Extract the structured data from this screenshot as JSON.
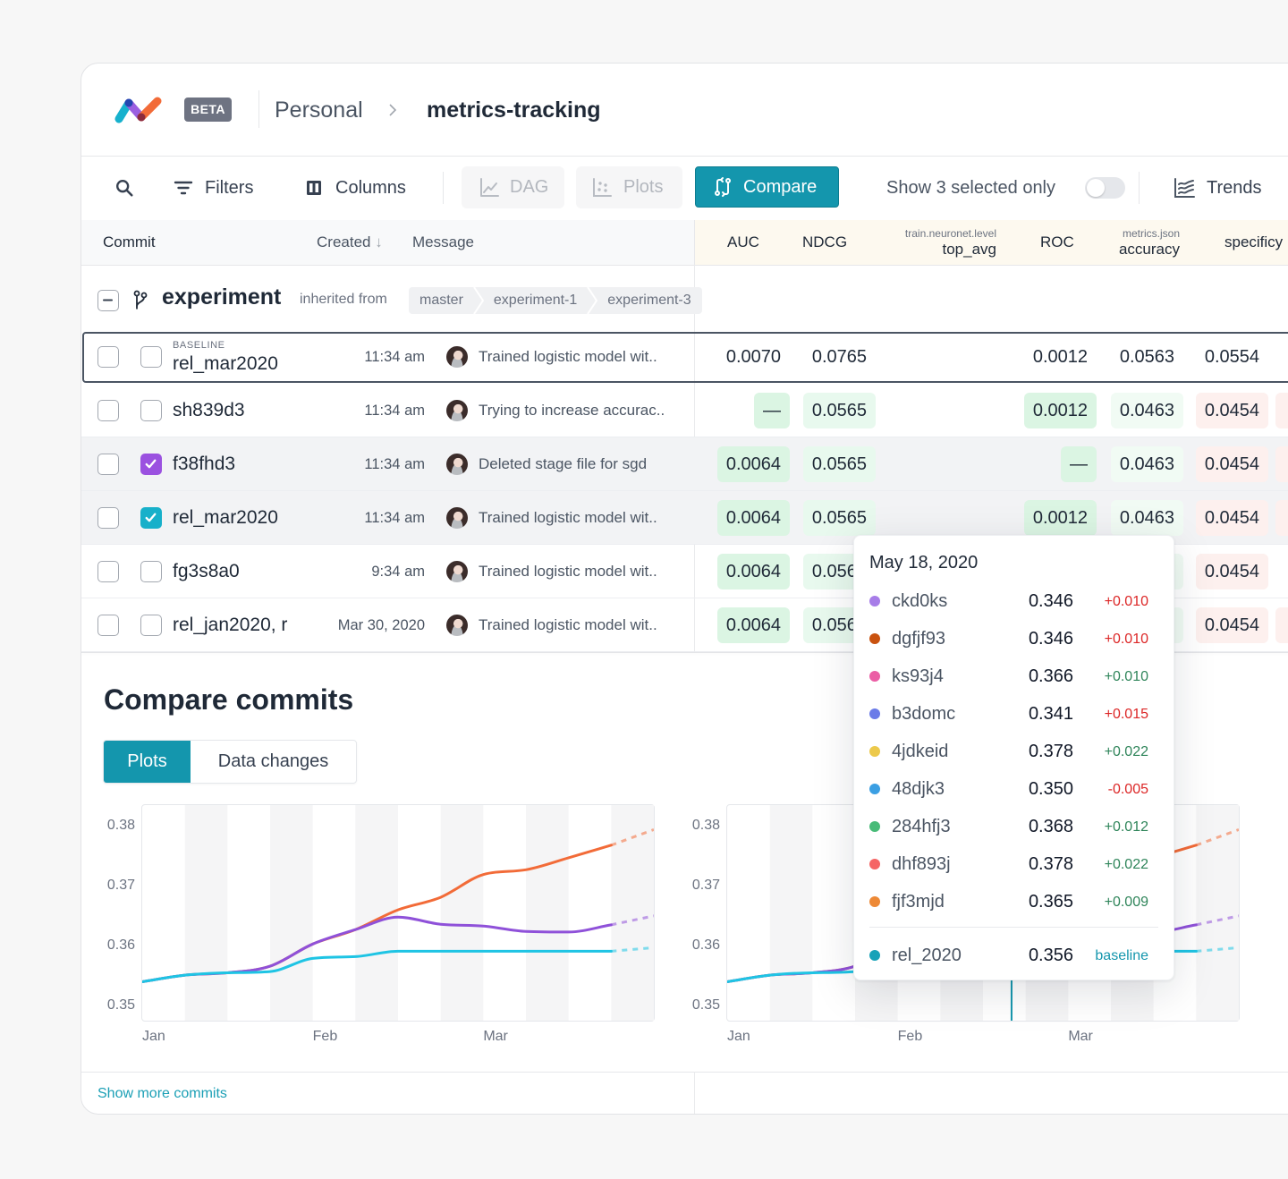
{
  "app": {
    "badge": "BETA"
  },
  "breadcrumb": {
    "workspace": "Personal",
    "project": "metrics-tracking"
  },
  "toolbar": {
    "filters": "Filters",
    "columns": "Columns",
    "dag": "DAG",
    "plots": "Plots",
    "compare": "Compare",
    "show_selected": "Show 3 selected only",
    "show_selected_on": false,
    "trends": "Trends"
  },
  "table": {
    "headers": {
      "commit": "Commit",
      "created": "Created",
      "created_sort": "↓",
      "message": "Message"
    },
    "metric_columns": [
      {
        "label": "AUC",
        "prefix": ""
      },
      {
        "label": "NDCG",
        "prefix": ""
      },
      {
        "label": "top_avg",
        "prefix": "train.neuronet.level"
      },
      {
        "label": "ROC",
        "prefix": ""
      },
      {
        "label": "accuracy",
        "prefix": "metrics.json"
      },
      {
        "label": "specificy",
        "prefix": ""
      }
    ],
    "group": {
      "name": "experiment",
      "inherited_label": "inherited from",
      "lineage": [
        "master",
        "experiment-1",
        "experiment-3"
      ]
    },
    "rows": [
      {
        "tag": "BASELINE",
        "commit": "rel_mar2020",
        "created": "11:34 am",
        "message": "Trained logistic model wit..",
        "selected": false,
        "compare": false,
        "compare_color": "",
        "highlighted": false,
        "metrics": [
          {
            "value": "0.0070",
            "tint": "none"
          },
          {
            "value": "0.0765",
            "tint": "none"
          },
          {
            "value": "",
            "tint": "none"
          },
          {
            "value": "0.0012",
            "tint": "none"
          },
          {
            "value": "0.0563",
            "tint": "none"
          },
          {
            "value": "0.0554",
            "tint": "none"
          },
          {
            "value": "",
            "tint": "none"
          }
        ]
      },
      {
        "tag": "",
        "commit": "sh839d3",
        "created": "11:34 am",
        "message": "Trying to increase accurac..",
        "selected": false,
        "compare": false,
        "compare_color": "",
        "highlighted": false,
        "metrics": [
          {
            "value": "—",
            "tint": "green-strong"
          },
          {
            "value": "0.0565",
            "tint": "green"
          },
          {
            "value": "",
            "tint": "none"
          },
          {
            "value": "0.0012",
            "tint": "green-strong"
          },
          {
            "value": "0.0463",
            "tint": "green-faint"
          },
          {
            "value": "0.0454",
            "tint": "red-faint"
          },
          {
            "value": "",
            "tint": "red-faint"
          }
        ]
      },
      {
        "tag": "",
        "commit": "f38fhd3",
        "created": "11:34 am",
        "message": "Deleted stage file for sgd",
        "selected": false,
        "compare": true,
        "compare_color": "#9b51e0",
        "highlighted": true,
        "metrics": [
          {
            "value": "0.0064",
            "tint": "green-strong"
          },
          {
            "value": "0.0565",
            "tint": "green"
          },
          {
            "value": "",
            "tint": "none"
          },
          {
            "value": "—",
            "tint": "green-strong"
          },
          {
            "value": "0.0463",
            "tint": "green-faint"
          },
          {
            "value": "0.0454",
            "tint": "red-faint"
          },
          {
            "value": "",
            "tint": "red-faint"
          }
        ]
      },
      {
        "tag": "",
        "commit": "rel_mar2020",
        "created": "11:34 am",
        "message": "Trained logistic model wit..",
        "selected": false,
        "compare": true,
        "compare_color": "#17b0ca",
        "highlighted": true,
        "metrics": [
          {
            "value": "0.0064",
            "tint": "green-strong"
          },
          {
            "value": "0.0565",
            "tint": "green"
          },
          {
            "value": "",
            "tint": "none"
          },
          {
            "value": "0.0012",
            "tint": "green-strong"
          },
          {
            "value": "0.0463",
            "tint": "green-faint"
          },
          {
            "value": "0.0454",
            "tint": "red-faint"
          },
          {
            "value": "",
            "tint": "red-faint"
          }
        ]
      },
      {
        "tag": "",
        "commit": "fg3s8a0",
        "created": "9:34 am",
        "message": "Trained logistic model wit..",
        "selected": false,
        "compare": false,
        "compare_color": "",
        "highlighted": false,
        "metrics": [
          {
            "value": "0.0064",
            "tint": "green-strong"
          },
          {
            "value": "0.0565",
            "tint": "green"
          },
          {
            "value": "",
            "tint": "none"
          },
          {
            "value": "",
            "tint": "none"
          },
          {
            "value": "",
            "tint": "green-faint"
          },
          {
            "value": "0.0454",
            "tint": "red-faint"
          },
          {
            "value": "",
            "tint": "none"
          }
        ]
      },
      {
        "tag": "",
        "commit": "rel_jan2020, r",
        "created": "Mar 30, 2020",
        "message": "Trained logistic model wit..",
        "selected": false,
        "compare": false,
        "compare_color": "",
        "highlighted": false,
        "metrics": [
          {
            "value": "0.0064",
            "tint": "green-strong"
          },
          {
            "value": "0.0565",
            "tint": "green"
          },
          {
            "value": "",
            "tint": "none"
          },
          {
            "value": "",
            "tint": "none"
          },
          {
            "value": "",
            "tint": "green-faint"
          },
          {
            "value": "0.0454",
            "tint": "red-faint"
          },
          {
            "value": "",
            "tint": "red-faint"
          }
        ]
      }
    ]
  },
  "compare": {
    "title": "Compare commits",
    "tabs": [
      {
        "label": "Plots",
        "active": true
      },
      {
        "label": "Data changes",
        "active": false
      }
    ],
    "show_more": "Show more commits"
  },
  "tooltip": {
    "date": "May 18, 2020",
    "items": [
      {
        "name": "ckd0ks",
        "value": "0.346",
        "delta": "+0.010",
        "color": "#a77de8",
        "delta_color": "#dc2626"
      },
      {
        "name": "dgfjf93",
        "value": "0.346",
        "delta": "+0.010",
        "color": "#c9520f",
        "delta_color": "#dc2626"
      },
      {
        "name": "ks93j4",
        "value": "0.366",
        "delta": "+0.010",
        "color": "#eb5ea5",
        "delta_color": "#2f855a"
      },
      {
        "name": "b3domc",
        "value": "0.341",
        "delta": "+0.015",
        "color": "#6b7be8",
        "delta_color": "#dc2626"
      },
      {
        "name": "4jdkeid",
        "value": "0.378",
        "delta": "+0.022",
        "color": "#ecc94b",
        "delta_color": "#2f855a"
      },
      {
        "name": "48djk3",
        "value": "0.350",
        "delta": "-0.005",
        "color": "#3b9fe3",
        "delta_color": "#dc2626"
      },
      {
        "name": "284hfj3",
        "value": "0.368",
        "delta": "+0.012",
        "color": "#48bb78",
        "delta_color": "#2f855a"
      },
      {
        "name": "dhf893j",
        "value": "0.378",
        "delta": "+0.022",
        "color": "#f56565",
        "delta_color": "#2f855a"
      },
      {
        "name": "fjf3mjd",
        "value": "0.365",
        "delta": "+0.009",
        "color": "#ed8936",
        "delta_color": "#2f855a"
      }
    ],
    "baseline": {
      "name": "rel_2020",
      "value": "0.356",
      "label": "baseline",
      "color": "#17a2b8",
      "label_color": "#1496ad"
    }
  },
  "chart_data": [
    {
      "type": "line",
      "title": "",
      "xlabel": "",
      "ylabel": "",
      "grid": false,
      "legend": "none",
      "xlim": [
        0,
        12
      ],
      "ylim": [
        0.3475,
        0.3835
      ],
      "x": [
        0,
        1,
        2,
        3,
        4,
        5,
        6,
        7,
        8,
        9,
        10,
        11,
        12
      ],
      "x_ticks": [
        {
          "at": 0,
          "label": "Jan"
        },
        {
          "at": 4,
          "label": "Feb"
        },
        {
          "at": 8,
          "label": "Mar"
        }
      ],
      "y_ticks": [
        {
          "value": 0.38,
          "label": "0.38"
        },
        {
          "value": 0.37,
          "label": "0.37"
        },
        {
          "value": 0.36,
          "label": "0.36"
        },
        {
          "value": 0.35,
          "label": "0.35"
        }
      ],
      "forecast_from": 11,
      "series": [
        {
          "color": "#f26b38",
          "values": [
            0.354,
            0.3551,
            0.3555,
            0.3566,
            0.3603,
            0.3627,
            0.366,
            0.3681,
            0.3719,
            0.3727,
            0.3747,
            0.3768,
            0.3794
          ]
        },
        {
          "color": "#8f51d9",
          "values": [
            0.354,
            0.3551,
            0.3555,
            0.3566,
            0.3603,
            0.3627,
            0.3648,
            0.3636,
            0.3633,
            0.3624,
            0.3623,
            0.3635,
            0.365
          ]
        },
        {
          "color": "#1ec4e4",
          "values": [
            0.354,
            0.3551,
            0.3555,
            0.3557,
            0.3579,
            0.3582,
            0.3591,
            0.3591,
            0.3591,
            0.3591,
            0.3591,
            0.3591,
            0.3597
          ]
        }
      ]
    },
    {
      "type": "line",
      "title": "",
      "xlabel": "",
      "ylabel": "",
      "grid": false,
      "legend": "none",
      "xlim": [
        0,
        12
      ],
      "ylim": [
        0.3475,
        0.3835
      ],
      "x": [
        0,
        1,
        2,
        3,
        4,
        5,
        6,
        7,
        8,
        9,
        10,
        11,
        12
      ],
      "x_ticks": [
        {
          "at": 0,
          "label": "Jan"
        },
        {
          "at": 4,
          "label": "Feb"
        },
        {
          "at": 8,
          "label": "Mar"
        }
      ],
      "y_ticks": [
        {
          "value": 0.38,
          "label": "0.38"
        },
        {
          "value": 0.37,
          "label": "0.37"
        },
        {
          "value": 0.36,
          "label": "0.36"
        },
        {
          "value": 0.35,
          "label": "0.35"
        }
      ],
      "forecast_from": 11,
      "cursor_x": 6.67,
      "cursor_color": "#1496ad",
      "series": [
        {
          "color": "#f26b38",
          "values": [
            0.354,
            0.3551,
            0.3555,
            0.3566,
            0.3603,
            0.3627,
            0.366,
            0.3681,
            0.3719,
            0.3727,
            0.3747,
            0.3768,
            0.3794
          ]
        },
        {
          "color": "#8f51d9",
          "values": [
            0.354,
            0.3551,
            0.3555,
            0.3566,
            0.3603,
            0.3627,
            0.3648,
            0.3636,
            0.3633,
            0.3624,
            0.3623,
            0.3635,
            0.365
          ]
        },
        {
          "color": "#1ec4e4",
          "values": [
            0.354,
            0.3551,
            0.3555,
            0.3557,
            0.3579,
            0.3582,
            0.3591,
            0.3591,
            0.3591,
            0.3591,
            0.3591,
            0.3591,
            0.3597
          ]
        }
      ]
    }
  ]
}
